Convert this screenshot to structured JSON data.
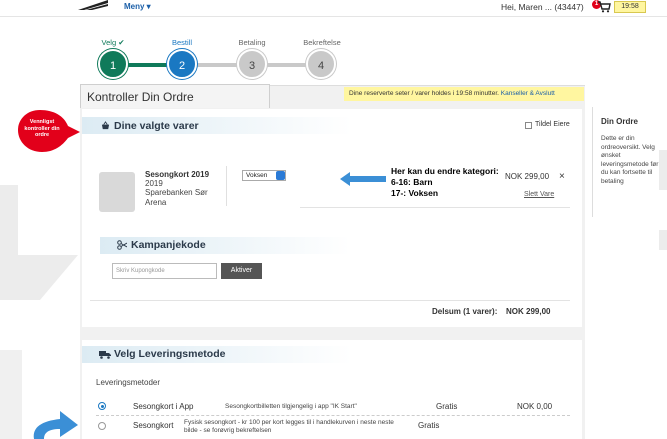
{
  "topbar": {
    "menu_label": "Meny ▾",
    "user_label": "Hei, Maren ... (43447)",
    "cart_count": "1",
    "timer": "19:58"
  },
  "steps": [
    {
      "label": "Velg ✔",
      "number": "1",
      "color": "#0f7a5a"
    },
    {
      "label": "Bestill",
      "number": "2",
      "color": "#1a78c2"
    },
    {
      "label": "Betaling",
      "number": "3",
      "color": "#c9c9c9"
    },
    {
      "label": "Bekreftelse",
      "number": "4",
      "color": "#c9c9c9"
    }
  ],
  "callout": {
    "text": "Vennligst kontroller din ordre"
  },
  "page_title": "Kontroller Din Ordre",
  "notice": {
    "text": "Dine reserverte seter / varer holdes i 19:58 minutter.",
    "link": "Kanseller & Avslutt"
  },
  "items_section": {
    "title": "Dine valgte varer",
    "gift_label": "Tildel Eiere",
    "item": {
      "name": "Sesongkort 2019",
      "year": "2019",
      "venue": "Sparebanken Sør Arena",
      "ticket_type": "Voksen",
      "price": "NOK 299,00",
      "delete_label": "Slett Vare",
      "close_glyph": "×"
    },
    "annotation": {
      "line1": "Her kan du endre kategori:",
      "line2": "6-16: Barn",
      "line3": "17-: Voksen"
    }
  },
  "campaign": {
    "title": "Kampanjekode",
    "placeholder": "Skriv Kupongkode",
    "button": "Aktiver"
  },
  "subtotal": {
    "label": "Delsum (1 varer):",
    "value": "NOK 299,00"
  },
  "delivery": {
    "title": "Velg Leveringsmetode",
    "subtitle": "Leveringsmetoder",
    "options": [
      {
        "name": "Sesongkort i App",
        "desc": "Sesongkortbilletten tilgjengelig i app \"IK Start\"",
        "fee": "Gratis",
        "price": "NOK 0,00",
        "selected": true
      },
      {
        "name": "Sesongkort",
        "desc": "Fysisk sesongkort - kr 100 per kort legges til i handlekurven i neste neste bilde - se forøvrig bekreftelsen",
        "fee": "Gratis",
        "price": "",
        "selected": false
      }
    ]
  },
  "sidebar": {
    "title": "Din Ordre",
    "text": "Dette er din ordreoversikt. Velg ønsket leveringsmetode før du kan fortsette til betaling"
  },
  "colors": {
    "accent": "#1a78c2",
    "done": "#0f7a5a",
    "callout": "#e2001a",
    "notice": "#fff6a0"
  }
}
